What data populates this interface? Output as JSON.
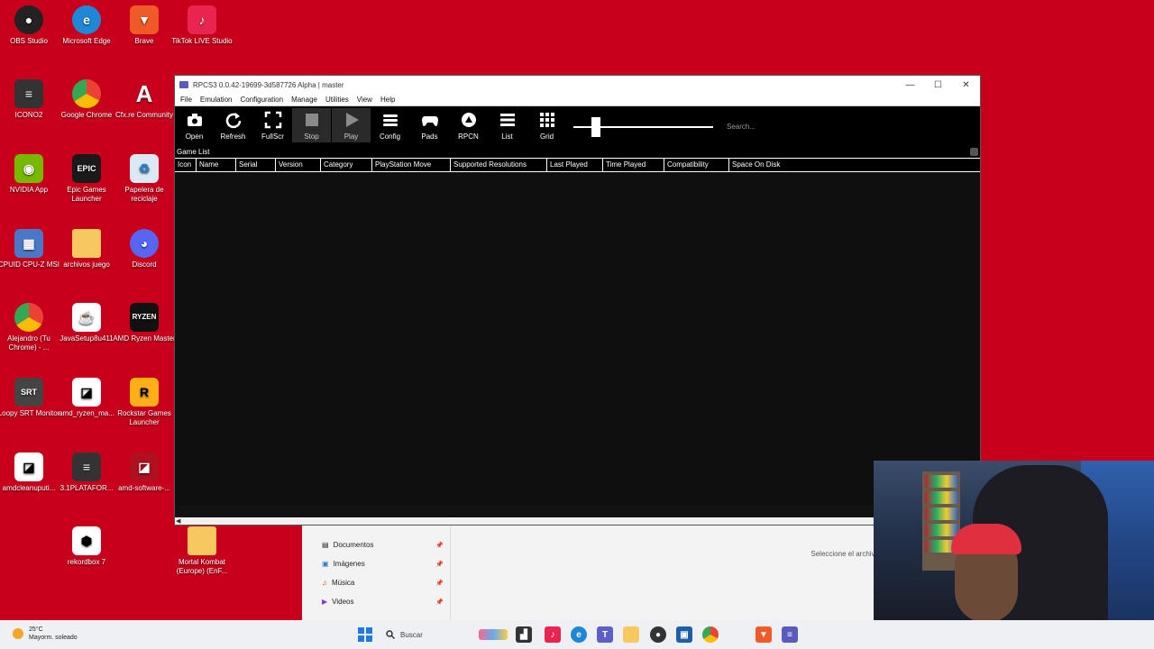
{
  "desktop": {
    "icons": [
      {
        "label": "OBS Studio"
      },
      {
        "label": "Microsoft Edge"
      },
      {
        "label": "Brave"
      },
      {
        "label": "TikTok LIVE Studio"
      },
      {
        "label": "ICONO2"
      },
      {
        "label": "Google Chrome"
      },
      {
        "label": "Cfx.re Community"
      },
      {
        "label": "NVIDIA App"
      },
      {
        "label": "Epic Games Launcher"
      },
      {
        "label": "Papelera de reciclaje"
      },
      {
        "label": "CPUID CPU-Z MSI"
      },
      {
        "label": "archivos juego"
      },
      {
        "label": "Discord"
      },
      {
        "label": "Alejandro (Tu Chrome) - ..."
      },
      {
        "label": "JavaSetup8u411"
      },
      {
        "label": "AMD Ryzen Master"
      },
      {
        "label": "Loopy SRT Monitor"
      },
      {
        "label": "amd_ryzen_ma..."
      },
      {
        "label": "Rockstar Games Launcher"
      },
      {
        "label": "amdcleanuputi..."
      },
      {
        "label": "3.1PLATAFOR..."
      },
      {
        "label": "amd-software-..."
      },
      {
        "label": "rekordbox 7"
      },
      {
        "label": "Mortal Kombat (Europe) (EnF..."
      }
    ]
  },
  "explorer": {
    "nav": [
      {
        "label": "Documentos"
      },
      {
        "label": "Imágenes"
      },
      {
        "label": "Música"
      },
      {
        "label": "Videos"
      }
    ],
    "hint": "Seleccione el archivo"
  },
  "rpcs3": {
    "title": "RPCS3 0.0.42-19699-3d587726 Alpha | master",
    "menu": [
      "File",
      "Emulation",
      "Configuration",
      "Manage",
      "Utilities",
      "View",
      "Help"
    ],
    "toolbar": {
      "open": "Open",
      "refresh": "Refresh",
      "fullscr": "FullScr",
      "stop": "Stop",
      "play": "Play",
      "config": "Config",
      "pads": "Pads",
      "rpcn": "RPCN",
      "list": "List",
      "grid": "Grid"
    },
    "search_placeholder": "Search...",
    "game_list_label": "Game List",
    "columns": [
      "Icon",
      "Name",
      "Serial",
      "Version",
      "Category",
      "PlayStation Move",
      "Supported Resolutions",
      "Last Played",
      "Time Played",
      "Compatibility",
      "Space On Disk"
    ]
  },
  "taskbar": {
    "weather_temp": "25°C",
    "weather_desc": "Mayorm. soleado",
    "search_label": "Buscar"
  },
  "colors": {
    "desktop_bg": "#c8001c",
    "rpcs3_bg": "#121212",
    "taskbar_bg": "#eef0f3"
  }
}
